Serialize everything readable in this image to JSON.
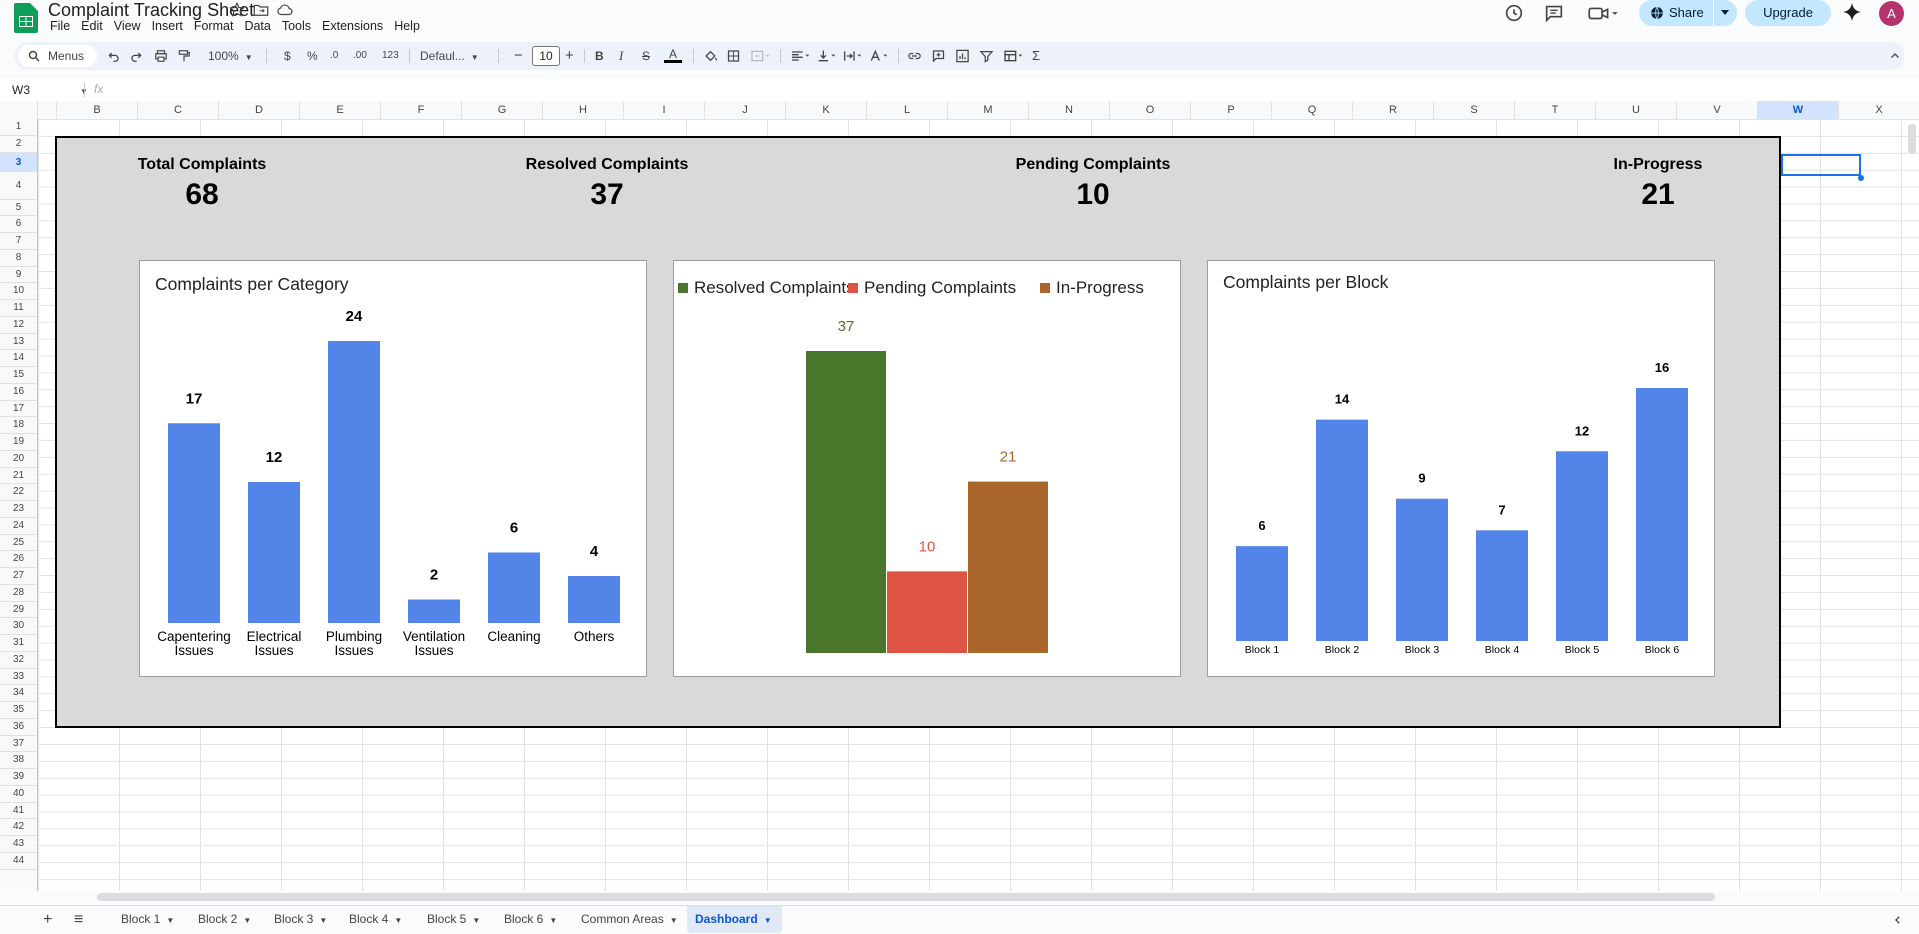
{
  "app": {
    "doc_title": "Complaint Tracking Sheet",
    "menus": [
      "File",
      "Edit",
      "View",
      "Insert",
      "Format",
      "Data",
      "Tools",
      "Extensions",
      "Help"
    ],
    "share_label": "Share",
    "upgrade_label": "Upgrade",
    "avatar_letter": "A",
    "brand_color": "#0f9d58"
  },
  "toolbar": {
    "search_placeholder": "Menus",
    "zoom": "100%",
    "currency": "$",
    "percent": "%",
    "dec_less": ".0",
    "dec_more": ".00",
    "number_format": "123",
    "font_name": "Defaul...",
    "font_size": "10",
    "bold": "B",
    "italic": "I",
    "text_color_glyph": "A",
    "sum": "Σ"
  },
  "formula_bar": {
    "cell_ref": "W3",
    "fx": "fx",
    "value": ""
  },
  "grid": {
    "columns": [
      "B",
      "C",
      "D",
      "E",
      "F",
      "G",
      "H",
      "I",
      "J",
      "K",
      "L",
      "M",
      "N",
      "O",
      "P",
      "Q",
      "R",
      "S",
      "T",
      "U",
      "V",
      "W",
      "X"
    ],
    "selected_column": "W",
    "rows": [
      "1",
      "2",
      "3",
      "4",
      "5",
      "6",
      "7",
      "8",
      "9",
      "10",
      "11",
      "12",
      "13",
      "14",
      "15",
      "16",
      "17",
      "18",
      "19",
      "20",
      "21",
      "22",
      "23",
      "24",
      "25",
      "26",
      "27",
      "28",
      "29",
      "30",
      "31",
      "32",
      "33",
      "34",
      "35",
      "36",
      "37",
      "38",
      "39",
      "40",
      "41",
      "42",
      "43",
      "44"
    ],
    "selected_row": "3"
  },
  "dashboard": {
    "kpis": [
      {
        "label": "Total Complaints",
        "value": "68"
      },
      {
        "label": "Resolved Complaints",
        "value": "37"
      },
      {
        "label": "Pending Complaints",
        "value": "10"
      },
      {
        "label": "In-Progress",
        "value": "21"
      }
    ]
  },
  "chart_data": [
    {
      "type": "bar",
      "title": "Complaints per Category",
      "categories": [
        [
          "Capentering",
          "Issues"
        ],
        [
          "Electrical",
          "Issues"
        ],
        [
          "Plumbing",
          "Issues"
        ],
        [
          "Ventilation",
          "Issues"
        ],
        [
          "Cleaning"
        ],
        [
          "Others"
        ]
      ],
      "values": [
        17,
        12,
        24,
        2,
        6,
        4
      ],
      "color": "#5385e8",
      "ylim": [
        0,
        24
      ],
      "grid": false,
      "data_labels": true
    },
    {
      "type": "bar",
      "title": "",
      "legend_position": "top",
      "series": [
        {
          "name": "Resolved Complaints",
          "values": [
            37
          ],
          "color": "#4a762b"
        },
        {
          "name": "Pending Complaints",
          "values": [
            10
          ],
          "color": "#de5444"
        },
        {
          "name": "In-Progress",
          "values": [
            21
          ],
          "color": "#a9652a"
        }
      ],
      "ylim": [
        0,
        37
      ],
      "grid": false,
      "data_labels": true
    },
    {
      "type": "bar",
      "title": "Complaints per Block",
      "categories": [
        "Block 1",
        "Block 2",
        "Block 3",
        "Block 4",
        "Block 5",
        "Block 6"
      ],
      "values": [
        6,
        14,
        9,
        7,
        12,
        16
      ],
      "color": "#5385e8",
      "ylim": [
        0,
        16
      ],
      "grid": false,
      "data_labels": true
    }
  ],
  "tabs": {
    "add_glyph": "+",
    "list_glyph": "≡",
    "items": [
      "Block 1",
      "Block 2",
      "Block 3",
      "Block 4",
      "Block 5",
      "Block 6",
      "Common Areas",
      "Dashboard"
    ],
    "active": "Dashboard"
  }
}
